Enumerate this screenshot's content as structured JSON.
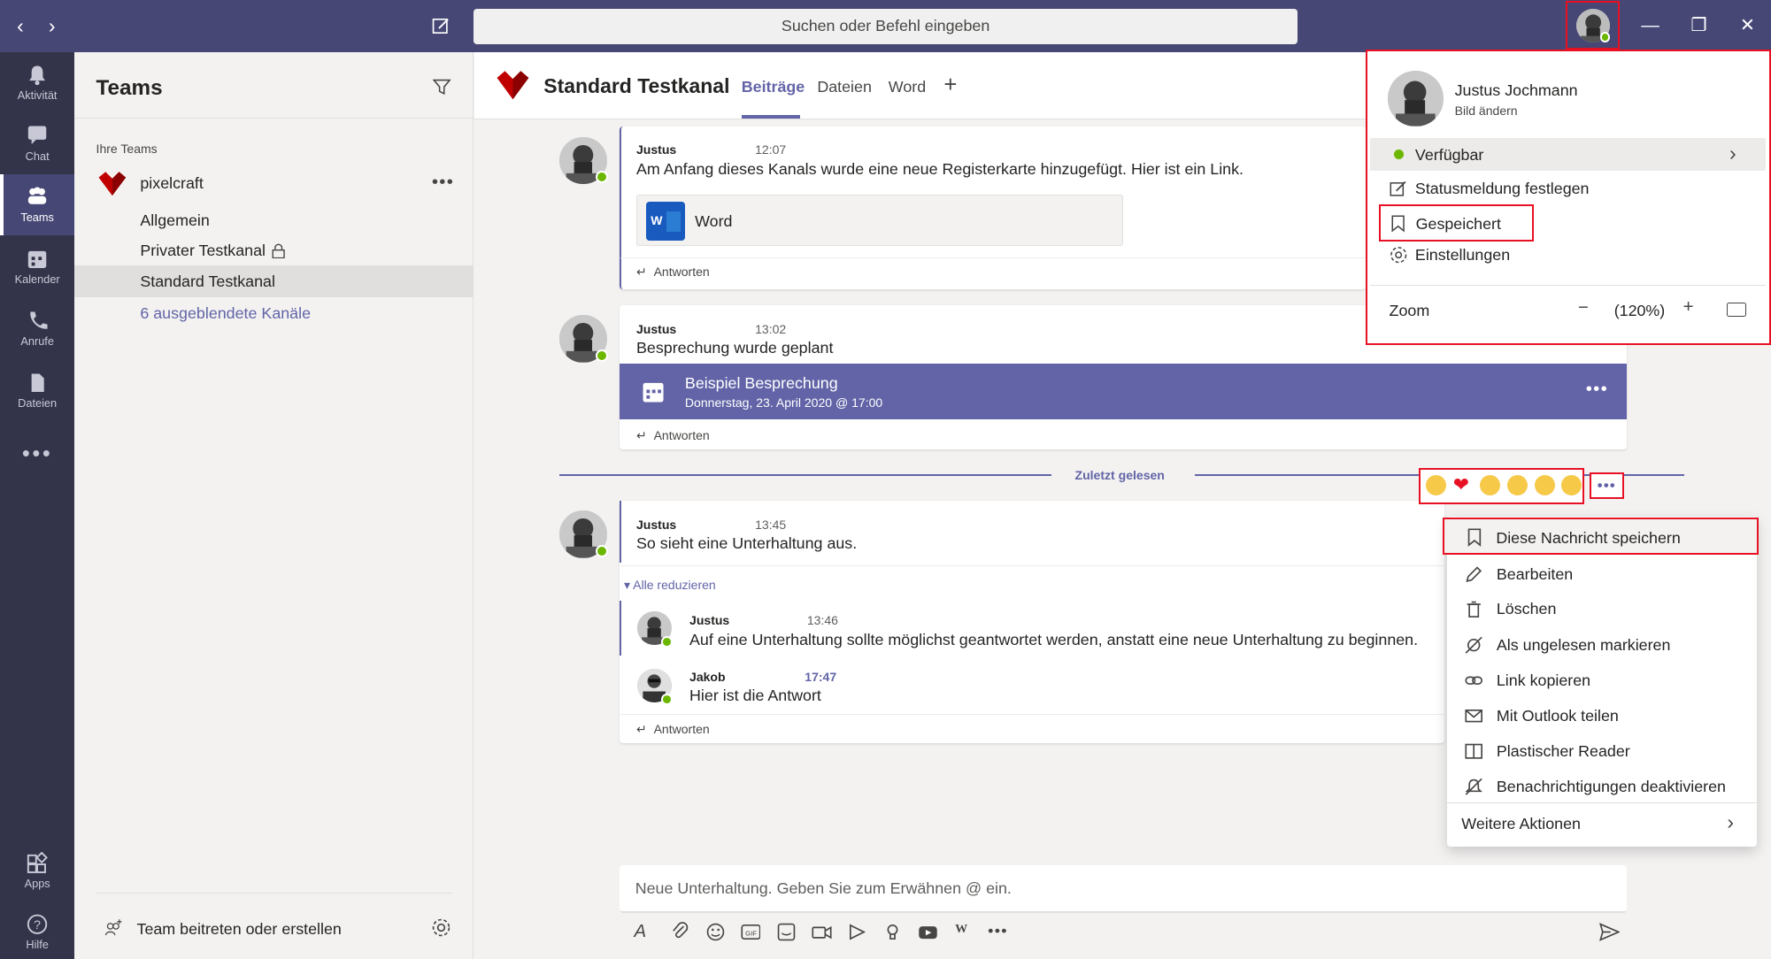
{
  "titlebar": {
    "search_placeholder": "Suchen oder Befehl eingeben"
  },
  "rail": [
    {
      "label": "Aktivität",
      "icon": "bell-icon"
    },
    {
      "label": "Chat",
      "icon": "chat-icon"
    },
    {
      "label": "Teams",
      "icon": "teams-icon",
      "active": true
    },
    {
      "label": "Kalender",
      "icon": "calendar-icon"
    },
    {
      "label": "Anrufe",
      "icon": "phone-icon"
    },
    {
      "label": "Dateien",
      "icon": "file-icon"
    }
  ],
  "rail_bottom": [
    {
      "label": "Apps",
      "icon": "apps-icon"
    },
    {
      "label": "Hilfe",
      "icon": "help-icon"
    }
  ],
  "teams_panel": {
    "title": "Teams",
    "section_label": "Ihre Teams",
    "team_name": "pixelcraft",
    "channels": [
      "Allgemein",
      "Privater Testkanal",
      "Standard Testkanal"
    ],
    "hidden_channels": "6 ausgeblendete Kanäle",
    "join_label": "Team beitreten oder erstellen"
  },
  "channel": {
    "name": "Standard Testkanal",
    "tabs": [
      "Beiträge",
      "Dateien",
      "Word"
    ]
  },
  "messages": {
    "m1": {
      "author": "Justus",
      "time": "12:07",
      "text": "Am Anfang dieses Kanals wurde eine neue Registerkarte hinzugefügt. Hier ist ein Link.",
      "attachment": "Word",
      "reply": "Antworten"
    },
    "m2": {
      "author": "Justus",
      "time": "13:02",
      "text": "Besprechung wurde geplant",
      "meeting_title": "Beispiel Besprechung",
      "meeting_date": "Donnerstag, 23. April 2020 @ 17:00",
      "reply": "Antworten"
    },
    "divider": "Zuletzt gelesen",
    "m3": {
      "author": "Justus",
      "time": "13:45",
      "text": "So sieht eine Unterhaltung aus.",
      "collapse": "Alle reduzieren",
      "reply": "Antworten"
    },
    "r1": {
      "author": "Justus",
      "time": "13:46",
      "text": "Auf eine Unterhaltung sollte möglichst geantwortet werden, anstatt eine neue Unterhaltung zu beginnen."
    },
    "r2": {
      "author": "Jakob",
      "time": "17:47",
      "text": "Hier ist die Antwort"
    }
  },
  "profile_menu": {
    "name": "Justus Jochmann",
    "change_picture": "Bild ändern",
    "status": "Verfügbar",
    "items": [
      "Statusmeldung festlegen",
      "Gespeichert",
      "Einstellungen"
    ],
    "zoom_label": "Zoom",
    "zoom_value": "(120%)"
  },
  "message_menu": {
    "items": [
      {
        "label": "Diese Nachricht speichern",
        "icon": "bookmark-icon"
      },
      {
        "label": "Bearbeiten",
        "icon": "pencil-icon"
      },
      {
        "label": "Löschen",
        "icon": "trash-icon"
      },
      {
        "label": "Als ungelesen markieren",
        "icon": "unread-icon"
      },
      {
        "label": "Link kopieren",
        "icon": "link-icon"
      },
      {
        "label": "Mit Outlook teilen",
        "icon": "mail-icon"
      },
      {
        "label": "Plastischer Reader",
        "icon": "reader-icon"
      },
      {
        "label": "Benachrichtigungen deaktivieren",
        "icon": "bell-off-icon"
      }
    ],
    "more_actions": "Weitere Aktionen"
  },
  "compose": {
    "placeholder": "Neue Unterhaltung. Geben Sie zum Erwähnen @ ein."
  },
  "colors": {
    "brand": "#464775",
    "accent": "#6264a7",
    "rail": "#33344a",
    "available": "#6bb700",
    "highlight": "#e81123"
  }
}
